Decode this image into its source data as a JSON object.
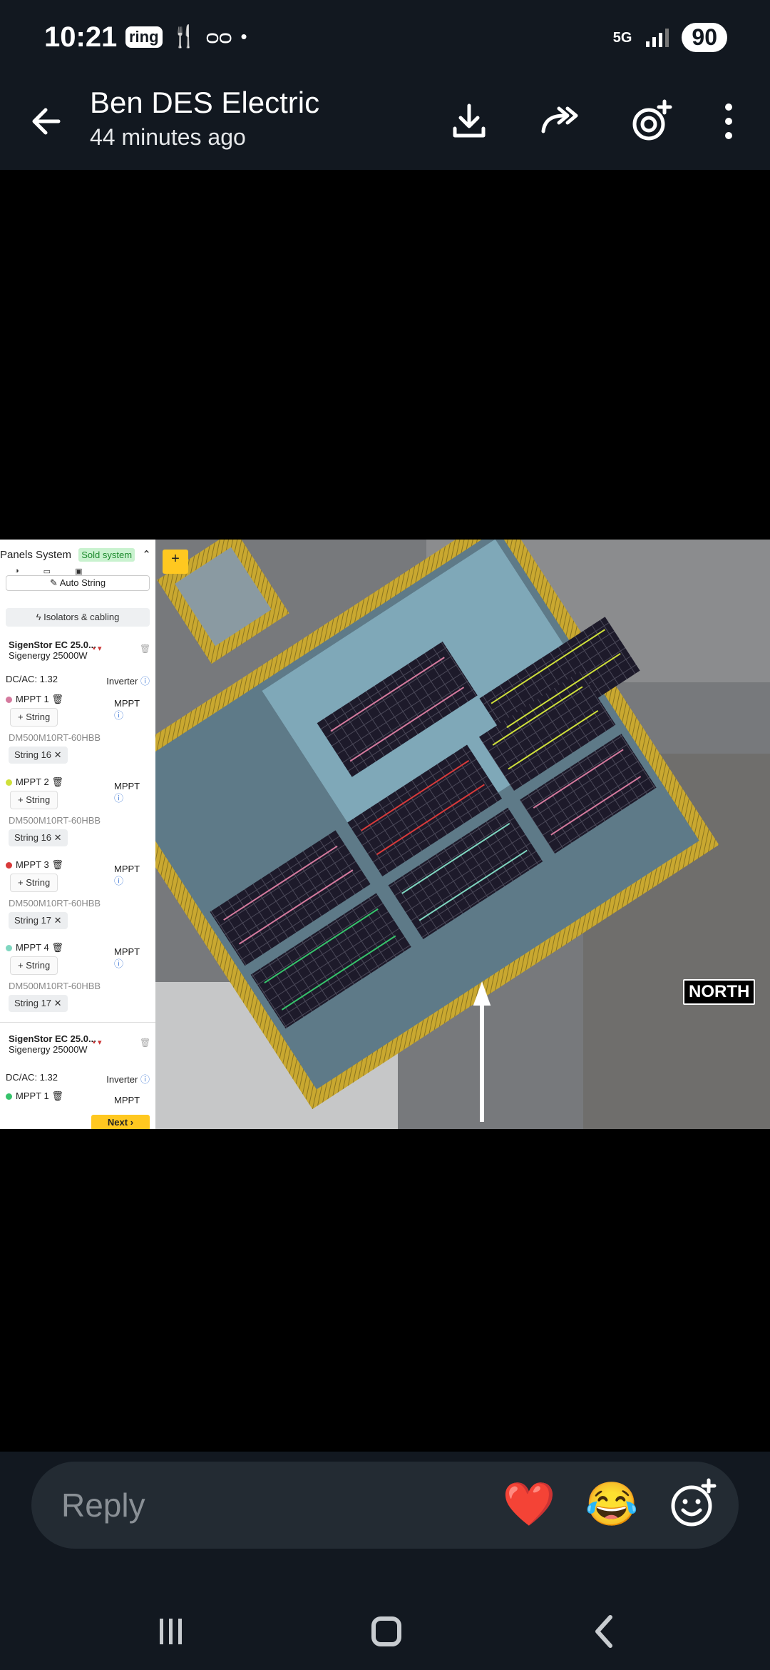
{
  "status_bar": {
    "time": "10:21",
    "app_badge": "ring",
    "network": "5G",
    "battery": "90"
  },
  "header": {
    "contact_name": "Ben DES Electric",
    "sent_time": "44 minutes ago"
  },
  "design_screenshot": {
    "panel_title": "Panels System",
    "sold_badge": "Sold system",
    "auto_string": "Auto String",
    "isolators": "Isolators & cabling",
    "inverters": [
      {
        "name": "SigenStor EC 25.0...",
        "model": "Sigenergy 25000W",
        "dcac": "DC/AC: 1.32",
        "inverter_label": "Inverter",
        "mppts": [
          {
            "label": "MPPT 1",
            "color": "#d57a9e",
            "add": "String",
            "panel": "DM500M10RT-60HBB",
            "string": "String 16"
          },
          {
            "label": "MPPT 2",
            "color": "#cfe03a",
            "add": "String",
            "panel": "DM500M10RT-60HBB",
            "string": "String 16"
          },
          {
            "label": "MPPT 3",
            "color": "#d83a3a",
            "add": "String",
            "panel": "DM500M10RT-60HBB",
            "string": "String 17"
          },
          {
            "label": "MPPT 4",
            "color": "#7fd6c0",
            "add": "String",
            "panel": "DM500M10RT-60HBB",
            "string": "String 17"
          }
        ]
      },
      {
        "name": "SigenStor EC 25.0...",
        "model": "Sigenergy 25000W",
        "dcac": "DC/AC: 1.32",
        "inverter_label": "Inverter",
        "mppts": [
          {
            "label": "MPPT 1",
            "color": "#36c36b"
          }
        ]
      }
    ],
    "mppt_tag": "MPPT",
    "next": "Next",
    "add_pa": "+",
    "north": "NORTH"
  },
  "reply": {
    "placeholder": "Reply",
    "quick_reactions": [
      "❤️",
      "😂"
    ]
  },
  "colors": {
    "background": "#121820",
    "reply_bar": "#232b33",
    "accent_yellow": "#ffc820"
  }
}
